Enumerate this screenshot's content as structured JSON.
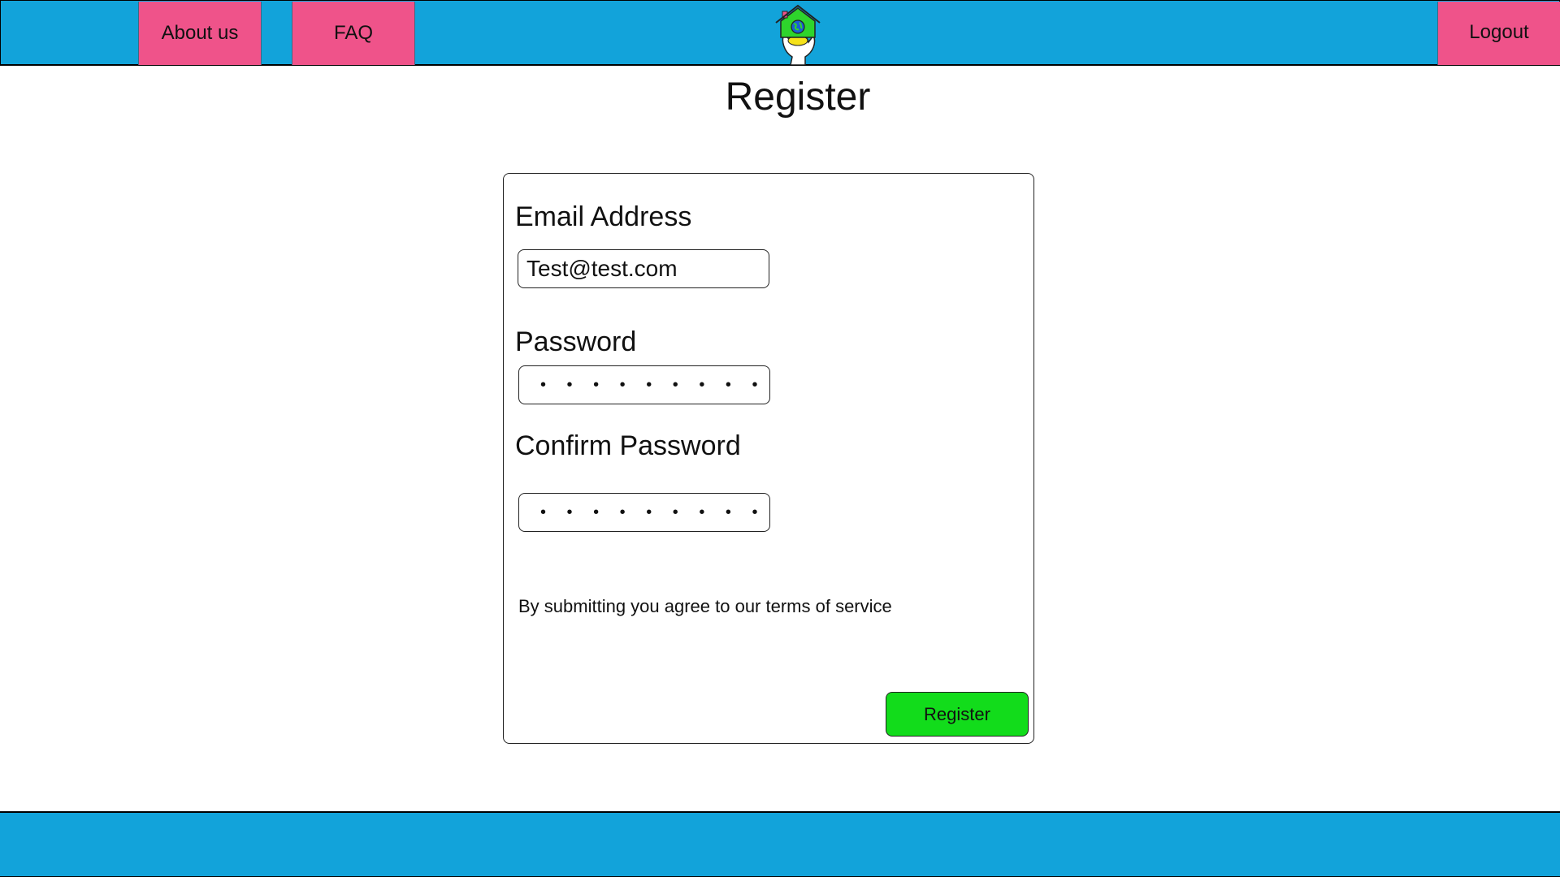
{
  "nav": {
    "about_label": "About us",
    "faq_label": "FAQ",
    "logout_label": "Logout"
  },
  "page": {
    "title": "Register"
  },
  "form": {
    "email_label": "Email Address",
    "email_value": "Test@test.com",
    "password_label": "Password",
    "password_mask": "• • • • • • • • •",
    "confirm_label": "Confirm Password",
    "confirm_mask": "• • • • • • • • •",
    "terms_text": "By submitting you agree to our terms of service",
    "submit_label": "Register"
  },
  "theme": {
    "header_color": "#12a3da",
    "nav_button_color": "#ef538a",
    "submit_color": "#12dc1b"
  }
}
